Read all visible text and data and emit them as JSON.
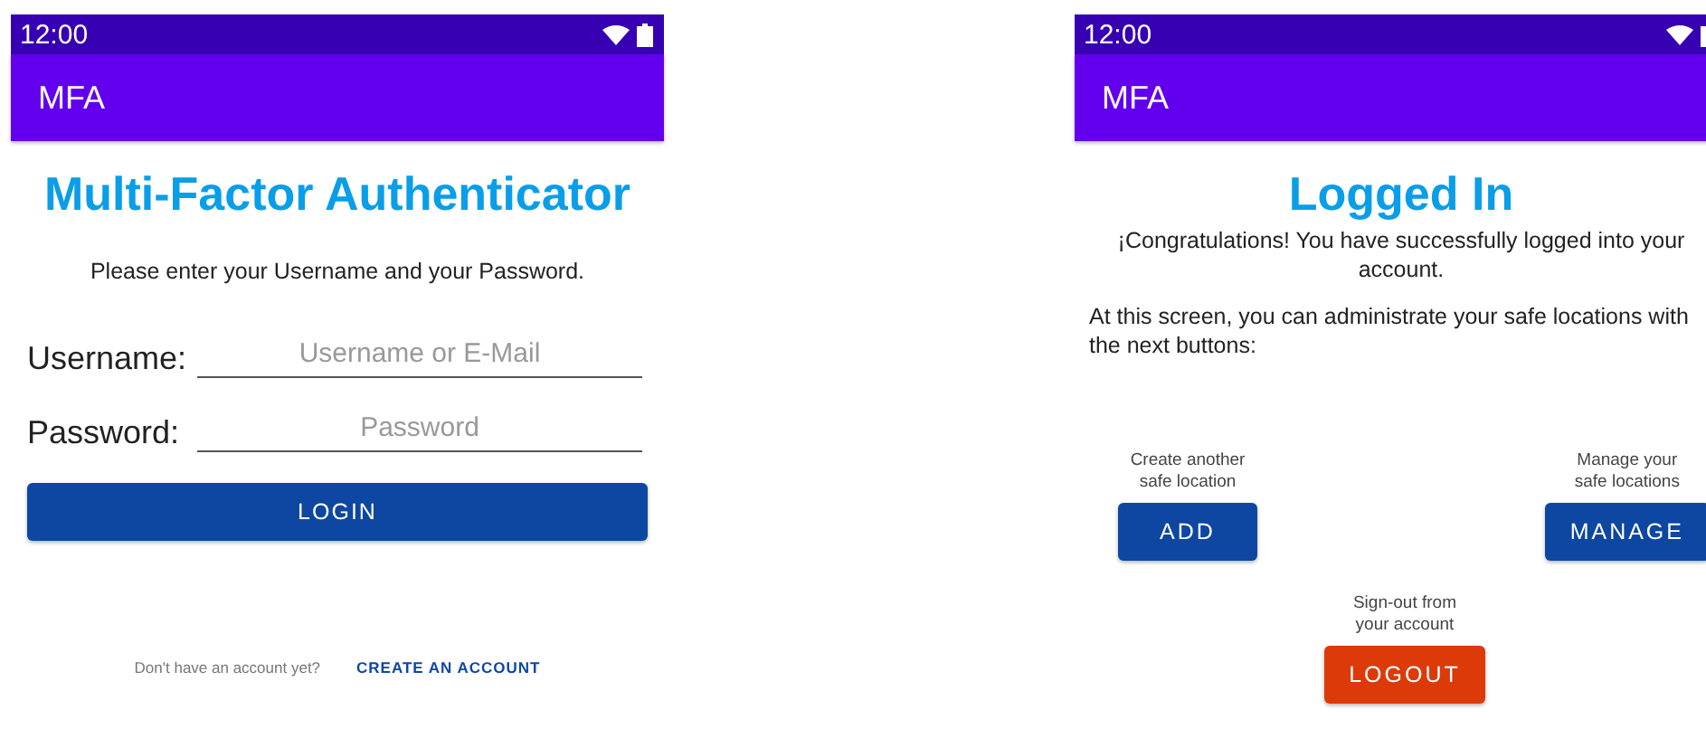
{
  "left_screen": {
    "status_bar": {
      "time": "12:00"
    },
    "app_bar": {
      "title": "MFA"
    },
    "heading": "Multi-Factor Authenticator",
    "instruction": "Please enter your Username and your Password.",
    "fields": [
      {
        "label": "Username:",
        "placeholder": "Username or E-Mail"
      },
      {
        "label": "Password:",
        "placeholder": "Password"
      }
    ],
    "login_button": "LOGIN",
    "footer": {
      "prompt": "Don't have an account yet?",
      "link": "CREATE AN ACCOUNT"
    }
  },
  "right_screen": {
    "status_bar": {
      "time": "12:00"
    },
    "app_bar": {
      "title": "MFA"
    },
    "heading": "Logged In",
    "message": "¡Congratulations! You have successfully logged into your account.",
    "instructions": "At this screen, you can administrate your safe locations with the next buttons:",
    "actions": [
      {
        "caption": "Create another safe location",
        "button": "ADD",
        "kind": "primary"
      },
      {
        "caption": "Manage your safe locations",
        "button": "MANAGE",
        "kind": "primary"
      },
      {
        "caption": "Sign-out from your account",
        "button": "LOGOUT",
        "kind": "danger"
      }
    ]
  }
}
